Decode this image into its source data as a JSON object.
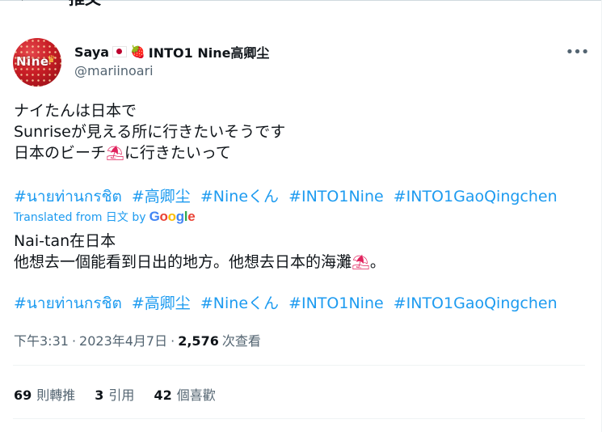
{
  "header": {
    "back_icon": "arrow-left-icon",
    "title": "推文"
  },
  "author": {
    "avatar_text": "Nine",
    "display_name_prefix": "Saya",
    "flag_icon": "japan-flag-icon",
    "strawberry_icon": "strawberry-icon",
    "display_name_suffix": "INTO1 Nine高卿尘",
    "handle": "@mariinoari"
  },
  "more_icon": "more-horizontal-icon",
  "tweet": {
    "lines": [
      "ナイたんは日本で",
      "Sunriseが見える所に行きたいそうです",
      "日本のビーチ",
      "に行きたいって"
    ],
    "umbrella_icon": "beach-umbrella-icon",
    "hashtags": [
      "#นายท่านกรชิต",
      "#高卿尘",
      "#Nineくん",
      "#INTO1Nine",
      "#INTO1GaoQingchen"
    ]
  },
  "translation": {
    "label": "Translated from 日文 by",
    "google": [
      "G",
      "o",
      "o",
      "g",
      "l",
      "e"
    ],
    "lines": [
      "Nai-tan在日本",
      "他想去一個能看到日出的地方。他想去日本的海灘",
      "。"
    ],
    "hashtags": [
      "#นายท่านกรชิต",
      "#高卿尘",
      "#Nineくん",
      "#INTO1Nine",
      "#INTO1GaoQingchen"
    ]
  },
  "meta": {
    "time": "下午3:31",
    "sep1": "·",
    "date": "2023年4月7日",
    "sep2": "·",
    "views_count": "2,576",
    "views_label": "次查看"
  },
  "stats": {
    "retweets_count": "69",
    "retweets_label": "則轉推",
    "quotes_count": "3",
    "quotes_label": "引用",
    "likes_count": "42",
    "likes_label": "個喜歡"
  },
  "colors": {
    "link": "#1d9bf0",
    "text": "#0f1419",
    "secondary": "#536471",
    "divider": "#eff3f4"
  }
}
